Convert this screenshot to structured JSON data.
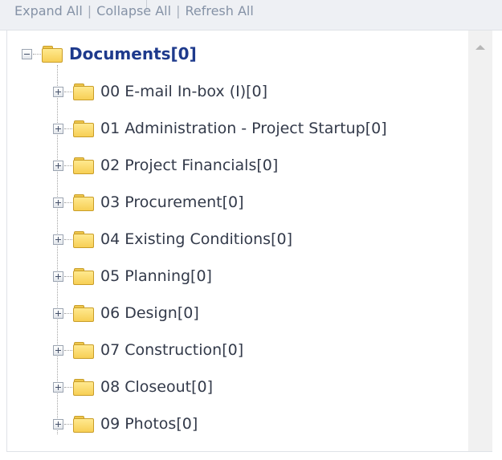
{
  "toolbar": {
    "expand_all": "Expand All",
    "collapse_all": "Collapse All",
    "refresh_all": "Refresh All",
    "separator": "|"
  },
  "tree": {
    "root": {
      "label": "Documents[0]",
      "expanded": true
    },
    "children": [
      {
        "label": "00 E-mail In-box (I)[0]"
      },
      {
        "label": "01 Administration - Project Startup[0]"
      },
      {
        "label": "02 Project Financials[0]"
      },
      {
        "label": "03 Procurement[0]"
      },
      {
        "label": "04 Existing Conditions[0]"
      },
      {
        "label": "05 Planning[0]"
      },
      {
        "label": "06 Design[0]"
      },
      {
        "label": "07 Construction[0]"
      },
      {
        "label": "08 Closeout[0]"
      },
      {
        "label": "09 Photos[0]"
      }
    ]
  },
  "icons": {
    "expander_collapse": "minus-box-icon",
    "expander_expand": "plus-box-icon",
    "folder": "folder-icon",
    "scroll_up": "scroll-up-arrow-icon"
  },
  "colors": {
    "root_label": "#1e3a8c",
    "child_label": "#333a4a",
    "toolbar_link": "#8592a6",
    "folder_fill": "#f7cf55"
  }
}
